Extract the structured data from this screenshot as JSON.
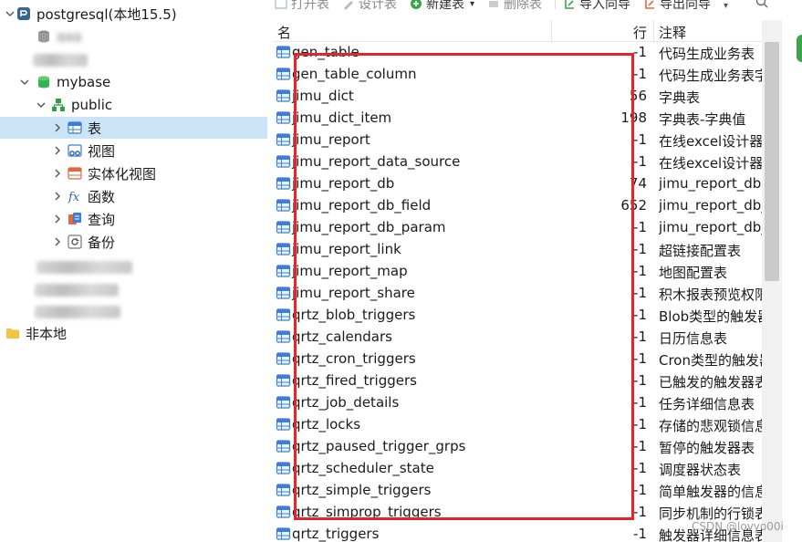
{
  "tree": {
    "connection": {
      "label": "postgresql(本地15.5)"
    },
    "db_blurred_1": {
      "label": "aaa"
    },
    "mybase": {
      "label": "mybase"
    },
    "public": {
      "label": "public"
    },
    "children": [
      {
        "label": "表",
        "icon": "table-icon"
      },
      {
        "label": "视图",
        "icon": "view-icon"
      },
      {
        "label": "实体化视图",
        "icon": "materialized-view-icon"
      },
      {
        "label": "函数",
        "icon": "function-icon"
      },
      {
        "label": "查询",
        "icon": "query-icon"
      },
      {
        "label": "备份",
        "icon": "backup-icon"
      }
    ],
    "group": {
      "label": "非本地"
    }
  },
  "toolbar": {
    "open": "打开表",
    "design": "设计表",
    "new": "新建表",
    "delete": "删除表",
    "import": "导入向导",
    "export": "导出向导"
  },
  "table": {
    "headers": {
      "name": "名",
      "rows": "行",
      "comment": "注释"
    },
    "rows": [
      {
        "name": "gen_table",
        "rows": "-1",
        "comment": "代码生成业务表"
      },
      {
        "name": "gen_table_column",
        "rows": "-1",
        "comment": "代码生成业务表字"
      },
      {
        "name": "jimu_dict",
        "rows": "56",
        "comment": "字典表"
      },
      {
        "name": "jimu_dict_item",
        "rows": "198",
        "comment": "字典表-字典值"
      },
      {
        "name": "jimu_report",
        "rows": "-1",
        "comment": "在线excel设计器"
      },
      {
        "name": "jimu_report_data_source",
        "rows": "-1",
        "comment": "在线excel设计器"
      },
      {
        "name": "jimu_report_db",
        "rows": "74",
        "comment": "jimu_report_db"
      },
      {
        "name": "jimu_report_db_field",
        "rows": "652",
        "comment": "jimu_report_db_"
      },
      {
        "name": "jimu_report_db_param",
        "rows": "-1",
        "comment": "jimu_report_db_"
      },
      {
        "name": "jimu_report_link",
        "rows": "-1",
        "comment": "超链接配置表"
      },
      {
        "name": "jimu_report_map",
        "rows": "-1",
        "comment": "地图配置表"
      },
      {
        "name": "jimu_report_share",
        "rows": "-1",
        "comment": "积木报表预览权限"
      },
      {
        "name": "qrtz_blob_triggers",
        "rows": "-1",
        "comment": "Blob类型的触发器"
      },
      {
        "name": "qrtz_calendars",
        "rows": "-1",
        "comment": "日历信息表"
      },
      {
        "name": "qrtz_cron_triggers",
        "rows": "-1",
        "comment": "Cron类型的触发器"
      },
      {
        "name": "qrtz_fired_triggers",
        "rows": "-1",
        "comment": "已触发的触发器表"
      },
      {
        "name": "qrtz_job_details",
        "rows": "-1",
        "comment": "任务详细信息表"
      },
      {
        "name": "qrtz_locks",
        "rows": "-1",
        "comment": "存储的悲观锁信息"
      },
      {
        "name": "qrtz_paused_trigger_grps",
        "rows": "-1",
        "comment": "暂停的触发器表"
      },
      {
        "name": "qrtz_scheduler_state",
        "rows": "-1",
        "comment": "调度器状态表"
      },
      {
        "name": "qrtz_simple_triggers",
        "rows": "-1",
        "comment": "简单触发器的信息"
      },
      {
        "name": "qrtz_simprop_triggers",
        "rows": "-1",
        "comment": "同步机制的行锁表"
      },
      {
        "name": "qrtz_triggers",
        "rows": "-1",
        "comment": "触发器详细信息表"
      }
    ]
  },
  "watermark": "CSDN @lovyo00i",
  "colors": {
    "selection": "#cce4f7",
    "annotation": "#e5252a",
    "db_green": "#2e9e47",
    "icon_blue": "#3a7fd5"
  }
}
